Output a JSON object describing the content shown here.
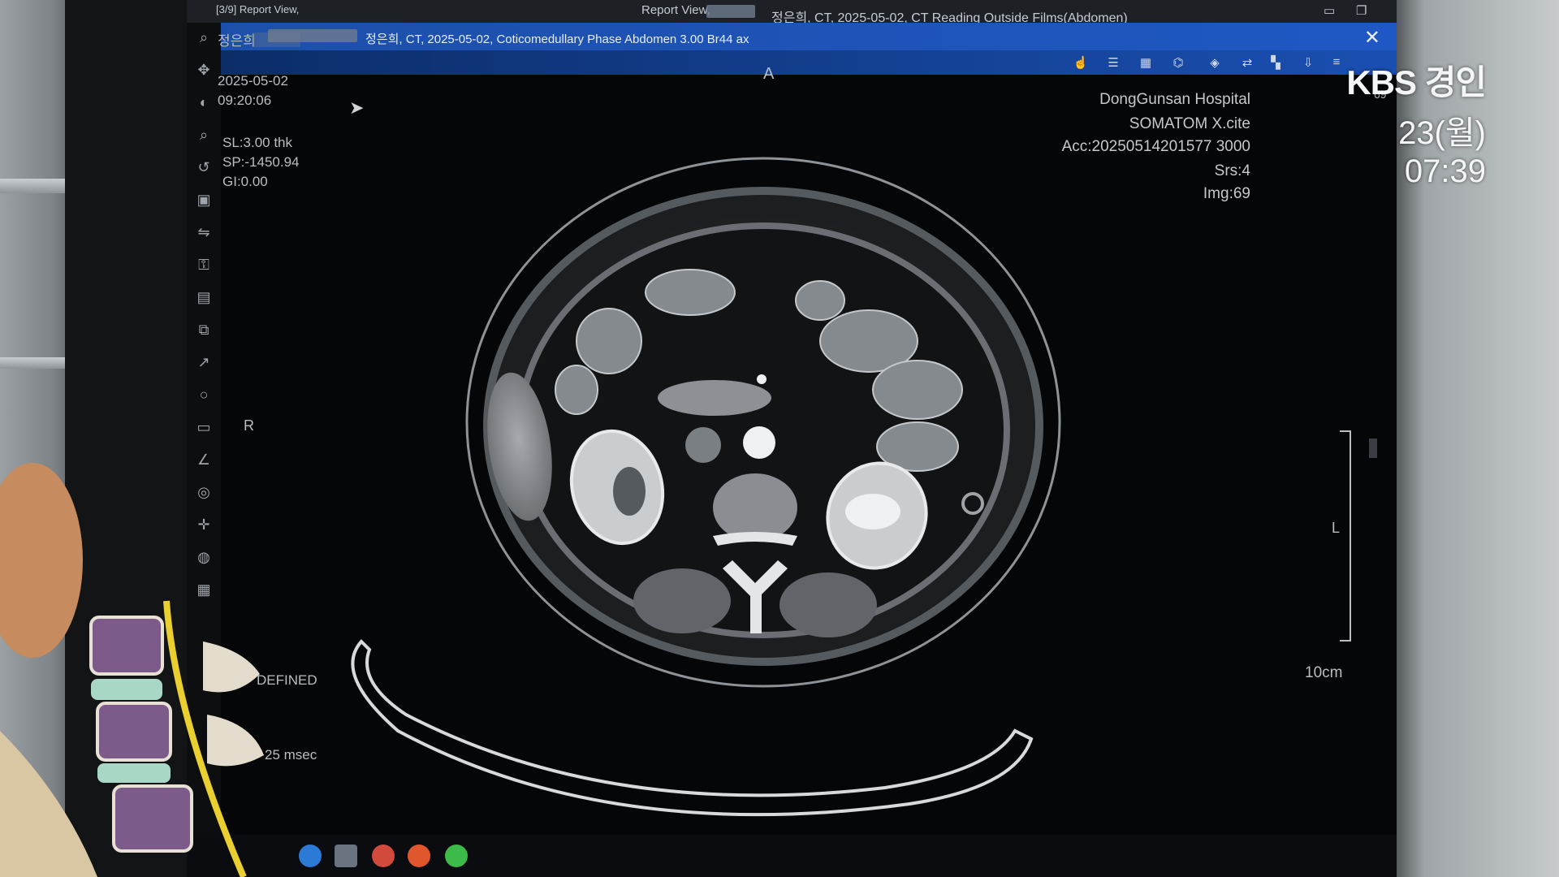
{
  "titlebar": {
    "left_label": "[3/9] Report View,",
    "center_label": "Report View,",
    "study_title": "정은희, CT, 2025-05-02, CT Reading Outside Films(Abdomen)"
  },
  "active_tab": {
    "title": "정은희, CT, 2025-05-02, Coticomedullary Phase Abdomen 3.00 Br44 ax",
    "close_glyph": "✕"
  },
  "overlay_left": {
    "patient_name": "정은희",
    "date": "2025-05-02",
    "time": "09:20:06",
    "slice": "SL:3.00 thk",
    "position": "SP:-1450.94",
    "gantry": "GI:0.00"
  },
  "overlay_right": {
    "hospital": "DongGunsan Hospital",
    "scanner": "SOMATOM X.cite",
    "accession": "Acc:20250514201577 3000",
    "series": "Srs:4",
    "image": "Img:69",
    "image_counter": "69"
  },
  "orientation": {
    "anterior": "A",
    "right": "R",
    "left": "L"
  },
  "scale_label": "10cm",
  "partial_labels": {
    "window": "DEFINED",
    "timing": "25 msec"
  },
  "broadcast": {
    "brand": "KBS 경인",
    "date": "23(월)",
    "time": "07:39"
  },
  "colors": {
    "tab_blue": "#1f58c4",
    "screen_bg": "#050607"
  }
}
